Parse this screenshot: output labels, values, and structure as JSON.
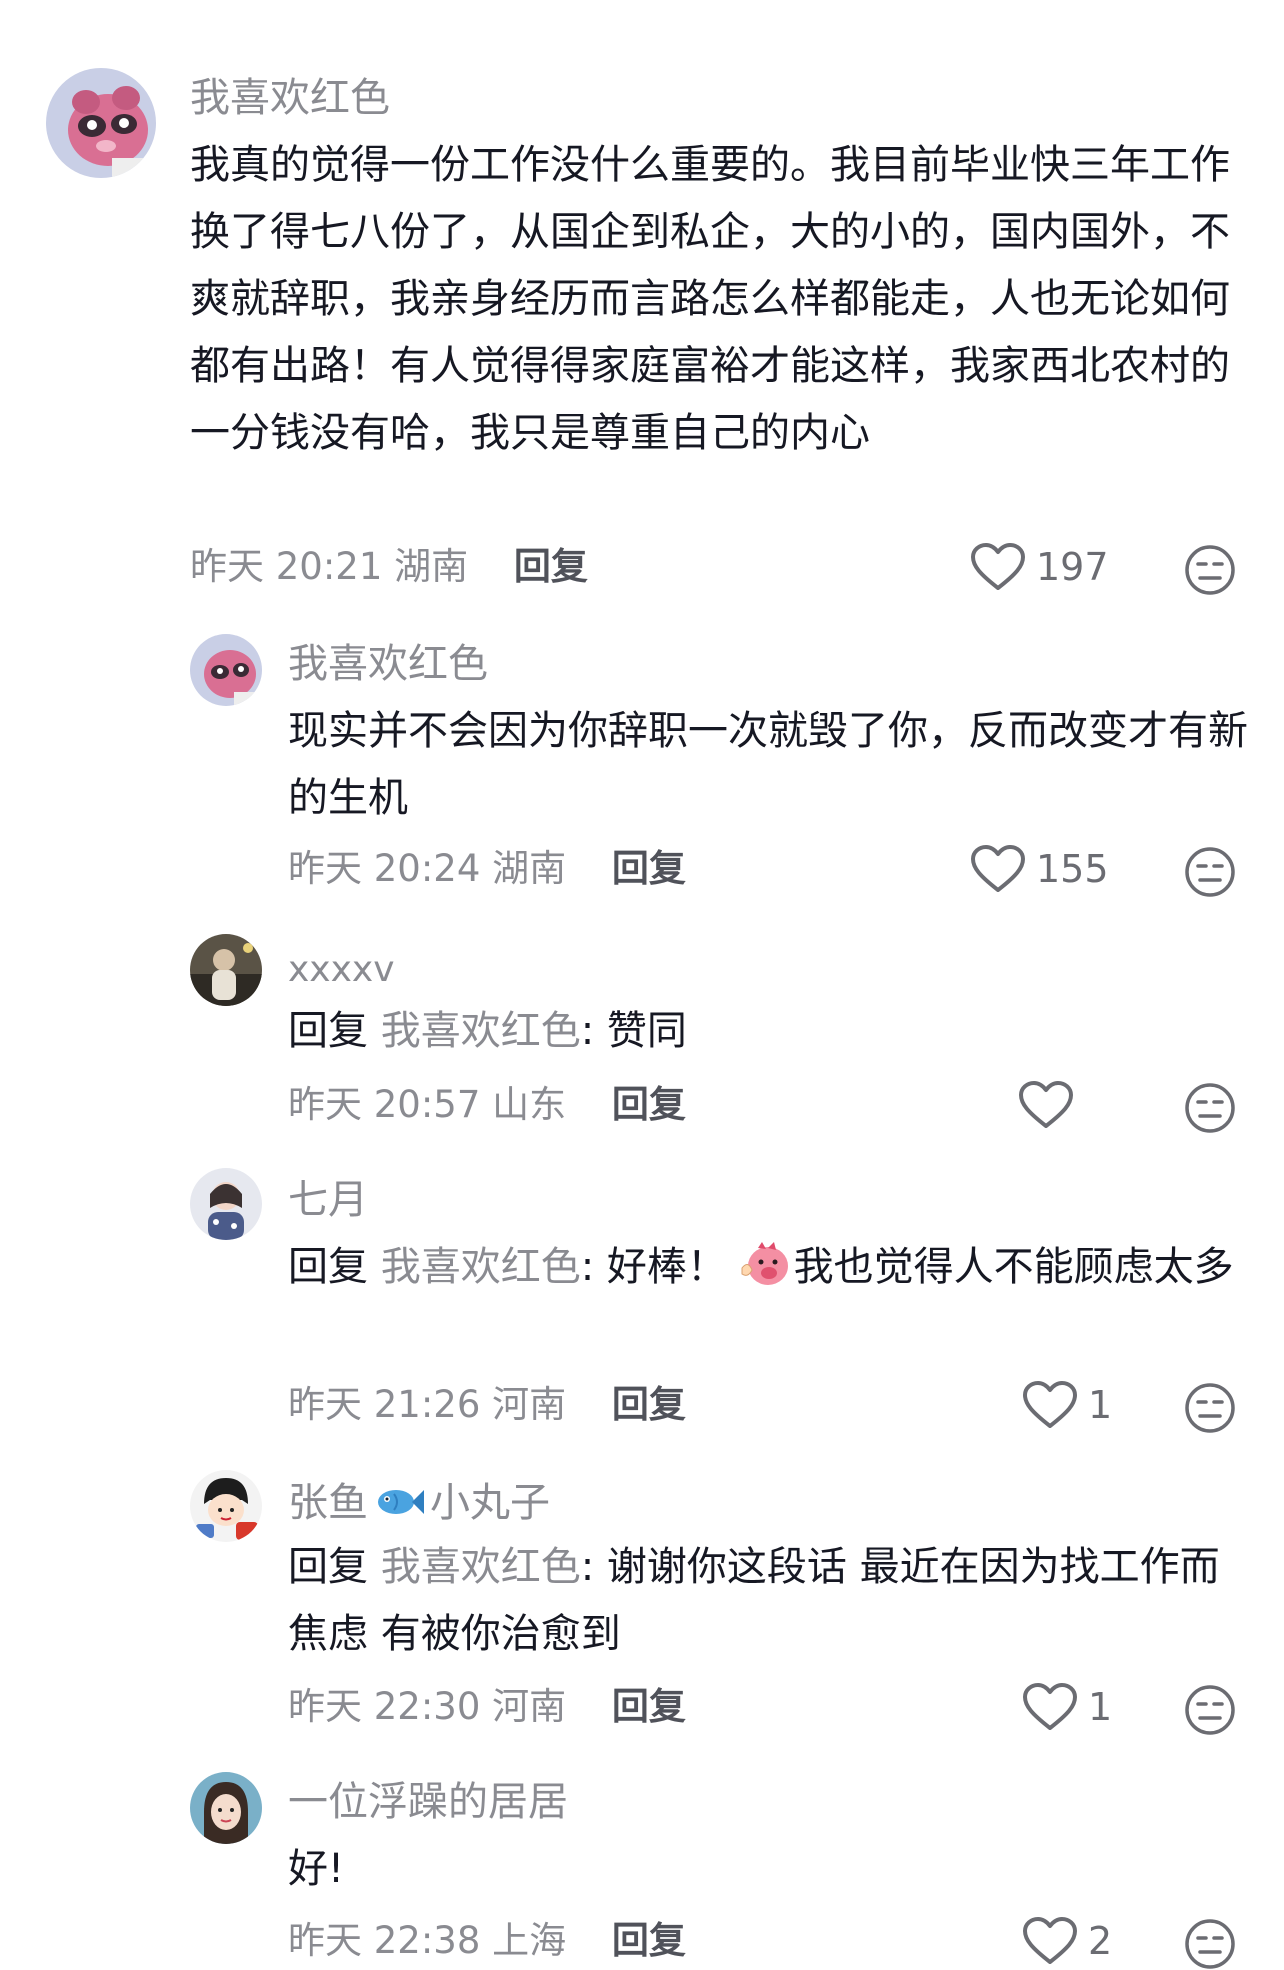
{
  "comments": [
    {
      "username": "我喜欢红色",
      "text": "我真的觉得一份工作没什么重要的。我目前毕业快三年工作换了得七八份了，从国企到私企，大的小的，国内国外，不爽就辞职，我亲身经历而言路怎么样都能走，人也无论如何都有出路！有人觉得得家庭富裕才能这样，我家西北农村的一分钱没有哈，我只是尊重自己的内心",
      "time": "昨天 20:21",
      "location": "湖南",
      "reply_label": "回复",
      "likes": "197",
      "avatar": "pink-panda-avatar"
    },
    {
      "username": "我喜欢红色",
      "text": "现实并不会因为你辞职一次就毁了你，反而改变才有新的生机",
      "time": "昨天 20:24",
      "location": "湖南",
      "reply_label": "回复",
      "likes": "155",
      "avatar": "pink-panda-avatar"
    },
    {
      "username": "xxxxv",
      "reply_prefix": "回复",
      "mention": "我喜欢红色",
      "text": ": 赞同",
      "time": "昨天 20:57",
      "location": "山东",
      "reply_label": "回复",
      "likes": "",
      "avatar": "photo-avatar"
    },
    {
      "username": "七月",
      "reply_prefix": "回复",
      "mention": "我喜欢红色",
      "text_before_emoji": ": 好棒！",
      "emoji": "clapping-pig-emoji",
      "text_after_emoji": "我也觉得人不能顾虑太多",
      "time": "昨天 21:26",
      "location": "河南",
      "reply_label": "回复",
      "likes": "1",
      "avatar": "girl-photo-avatar"
    },
    {
      "username_part1": "张鱼",
      "username_icon": "fish-emoji",
      "username_part2": "小丸子",
      "reply_prefix": "回复",
      "mention": "我喜欢红色",
      "text": ": 谢谢你这段话 最近在因为找工作而焦虑 有被你治愈到",
      "time": "昨天 22:30",
      "location": "河南",
      "reply_label": "回复",
      "likes": "1",
      "avatar": "cartoon-girl-avatar"
    },
    {
      "username": "一位浮躁的居居",
      "text": "好!",
      "time": "昨天 22:38",
      "location": "上海",
      "reply_label": "回复",
      "likes": "2",
      "avatar": "selfie-avatar"
    }
  ],
  "colors": {
    "secondary_text": "#8a8b91",
    "primary_text": "#161823",
    "icon_gray": "#6b6c72"
  }
}
